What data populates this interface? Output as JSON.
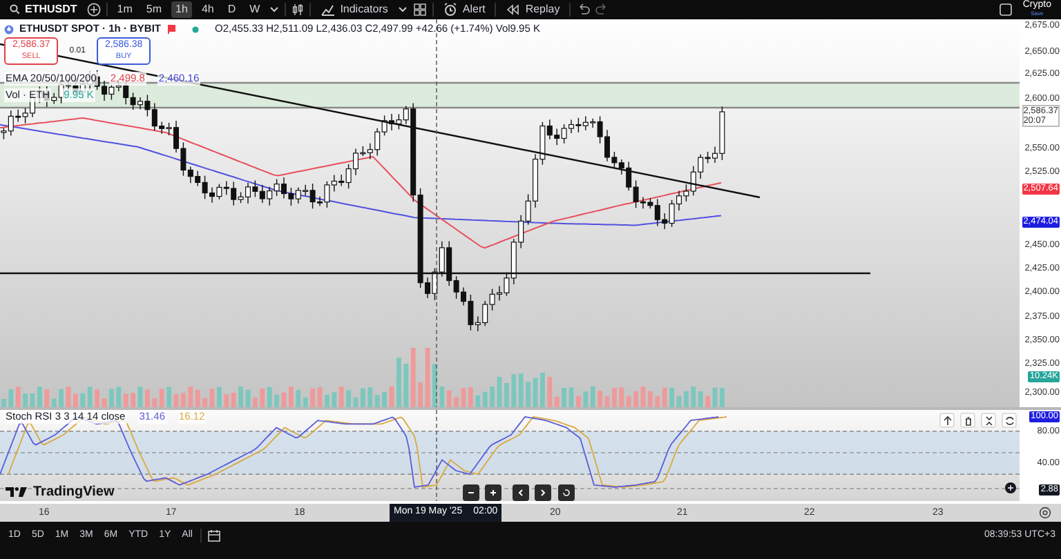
{
  "toolbar": {
    "symbol": "ETHUSDT",
    "intervals": [
      {
        "label": "1m",
        "selected": false
      },
      {
        "label": "5m",
        "selected": false
      },
      {
        "label": "1h",
        "selected": true
      },
      {
        "label": "4h",
        "selected": false
      },
      {
        "label": "D",
        "selected": false
      },
      {
        "label": "W",
        "selected": false
      }
    ],
    "buttons": [
      {
        "kind": "indicators",
        "label": "Indicators"
      },
      {
        "kind": "alert",
        "label": "Alert"
      },
      {
        "kind": "replay",
        "label": "Replay"
      }
    ],
    "layout": {
      "title": "Crypto",
      "subtitle": "Save"
    }
  },
  "legend": {
    "title": "ETHUSDT SPOT · 1h · BYBIT",
    "ohlc": "O2,455.33 H2,511.09 L2,436.03 C2,497.99 +42.66 (+1.74%) Vol9.95 K",
    "sell": {
      "price": "2,586.37",
      "label": "SELL"
    },
    "spread": "0.01",
    "buy": {
      "price": "2,586.38",
      "label": "BUY"
    },
    "studies": [
      {
        "name": "EMA 20/50/100/200",
        "values": [
          {
            "text": "2,499.8",
            "color": "#e0404a"
          },
          {
            "text": "2,460.16",
            "color": "#3f3fd0"
          }
        ]
      },
      {
        "name": "Vol · ETH",
        "values": [
          {
            "text": "9.95 K",
            "color": "#26a69a"
          }
        ]
      }
    ]
  },
  "price_axis": [
    {
      "text": "2,675.00",
      "kind": "label"
    },
    {
      "text": "2,650.00",
      "kind": "label"
    },
    {
      "text": "2,625.00",
      "kind": "label"
    },
    {
      "text": "2,600.00",
      "kind": "label"
    },
    {
      "text": "2,586.37",
      "kind": "current",
      "sub": "20:07"
    },
    {
      "text": "2,550.00",
      "kind": "label"
    },
    {
      "text": "2,525.00",
      "kind": "label"
    },
    {
      "text": "2,507.64",
      "kind": "tag",
      "color": "#f23645"
    },
    {
      "text": "2,474.04",
      "kind": "tag",
      "color": "#1e1ee0"
    },
    {
      "text": "2,450.00",
      "kind": "label"
    },
    {
      "text": "2,425.00",
      "kind": "label"
    },
    {
      "text": "2,400.00",
      "kind": "label"
    },
    {
      "text": "2,375.00",
      "kind": "label"
    },
    {
      "text": "2,350.00",
      "kind": "label"
    },
    {
      "text": "2,325.00",
      "kind": "label"
    },
    {
      "text": "10.24K",
      "kind": "tag",
      "color": "#26a69a"
    },
    {
      "text": "2,300.00",
      "kind": "label"
    }
  ],
  "stoch_rsi": {
    "title": "Stoch RSI 3 3 14 14 close",
    "values": [
      {
        "text": "31.46",
        "color": "#5b5bd6"
      },
      {
        "text": "16.12",
        "color": "#d9a93c"
      }
    ],
    "axis": [
      {
        "text": "100.00",
        "kind": "tag",
        "color": "#1e1ee0"
      },
      {
        "text": "80.00",
        "kind": "label"
      },
      {
        "text": "40.00",
        "kind": "label"
      },
      {
        "text": "2.88",
        "kind": "tag",
        "color": "#131722"
      }
    ]
  },
  "logo": "TradingView",
  "time_axis": [
    {
      "kind": "label",
      "text": "16"
    },
    {
      "kind": "label",
      "text": "17"
    },
    {
      "kind": "label",
      "text": "18"
    },
    {
      "kind": "crosshair",
      "text": "Mon 19 May '25",
      "time": "02:00"
    },
    {
      "kind": "label",
      "text": "20"
    },
    {
      "kind": "label",
      "text": "21"
    },
    {
      "kind": "label",
      "text": "22"
    },
    {
      "kind": "label",
      "text": "23"
    }
  ],
  "bottom_bar": {
    "ranges": [
      "1D",
      "5D",
      "1M",
      "3M",
      "6M",
      "YTD",
      "1Y",
      "All"
    ],
    "clock": "08:39:53 UTC+3"
  }
}
